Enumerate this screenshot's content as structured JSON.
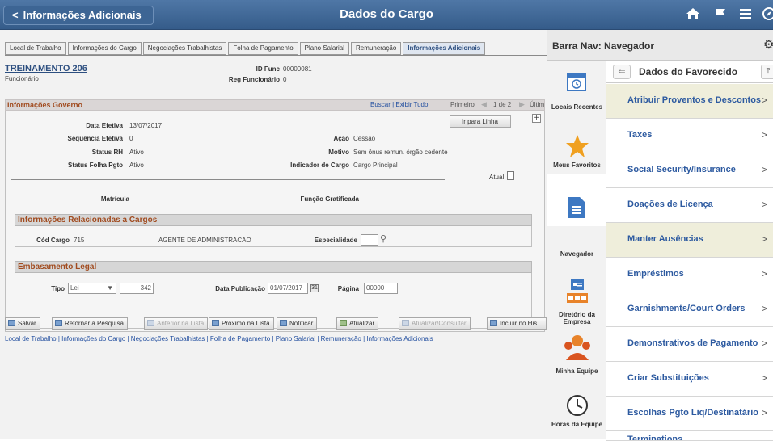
{
  "header": {
    "back_label": "Informações Adicionais",
    "title": "Dados do Cargo",
    "icons": [
      "home-icon",
      "flag-icon",
      "menu-icon",
      "compass-icon"
    ]
  },
  "tabs": [
    {
      "label": "Local de Trabalho",
      "active": false
    },
    {
      "label": "Informações do Cargo",
      "active": false
    },
    {
      "label": "Negociações Trabalhistas",
      "active": false
    },
    {
      "label": "Folha de Pagamento",
      "active": false
    },
    {
      "label": "Plano Salarial",
      "active": false
    },
    {
      "label": "Remuneração",
      "active": false
    },
    {
      "label": "Informações Adicionais",
      "active": true
    }
  ],
  "employee": {
    "name": "TREINAMENTO 206",
    "role": "Funcionário",
    "id_func_label": "ID Func",
    "id_func": "00000081",
    "reg_label": "Reg Funcionário",
    "reg": "0"
  },
  "info_governo": {
    "title": "Informações Governo",
    "links": "Buscar | Exibir Tudo",
    "nav_first": "Primeiro",
    "nav_count": "1 de 2",
    "nav_last": "Últim",
    "goto_label": "Ir para Linha",
    "data_efetiva_label": "Data Efetiva",
    "data_efetiva": "13/07/2017",
    "acao_label": "Ação",
    "acao": "Cessão",
    "seq_label": "Sequência Efetiva",
    "seq": "0",
    "motivo_label": "Motivo",
    "motivo": "Sem ônus remun. órgão cedente",
    "status_rh_label": "Status RH",
    "status_rh": "Ativo",
    "indicador_label": "Indicador de Cargo",
    "indicador": "Cargo Principal",
    "status_folha_label": "Status Folha Pgto",
    "status_folha": "Ativo",
    "atual_label": "Atual",
    "matricula_label": "Matrícula",
    "funcao_label": "Função Gratificada"
  },
  "cargos": {
    "title": "Informações Relacionadas a Cargos",
    "cod_label": "Cód Cargo",
    "cod": "715",
    "cargo_desc": "AGENTE DE ADMINISTRACAO",
    "espec_label": "Especialidade"
  },
  "embasamento": {
    "title": "Embasamento Legal",
    "tipo_label": "Tipo",
    "tipo": "Lei",
    "numero": "342",
    "data_label": "Data Publicação",
    "data": "01/07/2017",
    "pagina_label": "Página",
    "pagina": "00000"
  },
  "toolbar": {
    "salvar": "Salvar",
    "retornar": "Retornar à Pesquisa",
    "anterior": "Anterior na Lista",
    "proximo": "Próximo na Lista",
    "notificar": "Notificar",
    "atualizar": "Atualizar",
    "atualizar_consultar": "Atualizar/Consultar",
    "incluir": "Incluir no His"
  },
  "footer_links": "Local de Trabalho | Informações do Cargo | Negociações Trabalhistas | Folha de Pagamento | Plano Salarial | Remuneração | Informações Adicionais",
  "right_panel": {
    "title": "Barra Nav: Navegador",
    "rail": [
      {
        "label": "Locais Recentes",
        "icon": "calendar-clock-icon"
      },
      {
        "label": "Meus Favoritos",
        "icon": "star-icon"
      },
      {
        "label": "Navegador",
        "icon": "document-icon"
      },
      {
        "label": "Diretório da Empresa",
        "icon": "directory-icon"
      },
      {
        "label": "Minha Equipe",
        "icon": "team-icon"
      },
      {
        "label": "Horas da Equipe",
        "icon": "clock-icon"
      }
    ],
    "nav_title": "Dados do Favorecido",
    "items": [
      "Atribuir Proventos e Descontos",
      "Taxes",
      "Social Security/Insurance",
      "Doações de Licença",
      "Manter Ausências",
      "Empréstimos",
      "Garnishments/Court Orders",
      "Demonstrativos de Pagamento",
      "Criar Substituições",
      "Escolhas Pgto Liq/Destinatário",
      "Terminations"
    ]
  },
  "colors": {
    "header_bg": "#4a72a2",
    "link": "#2450a0",
    "section_title": "#a14b1f",
    "nav_item": "#2d5aa0",
    "highlight": "#efeedb",
    "star": "#f0a020"
  }
}
